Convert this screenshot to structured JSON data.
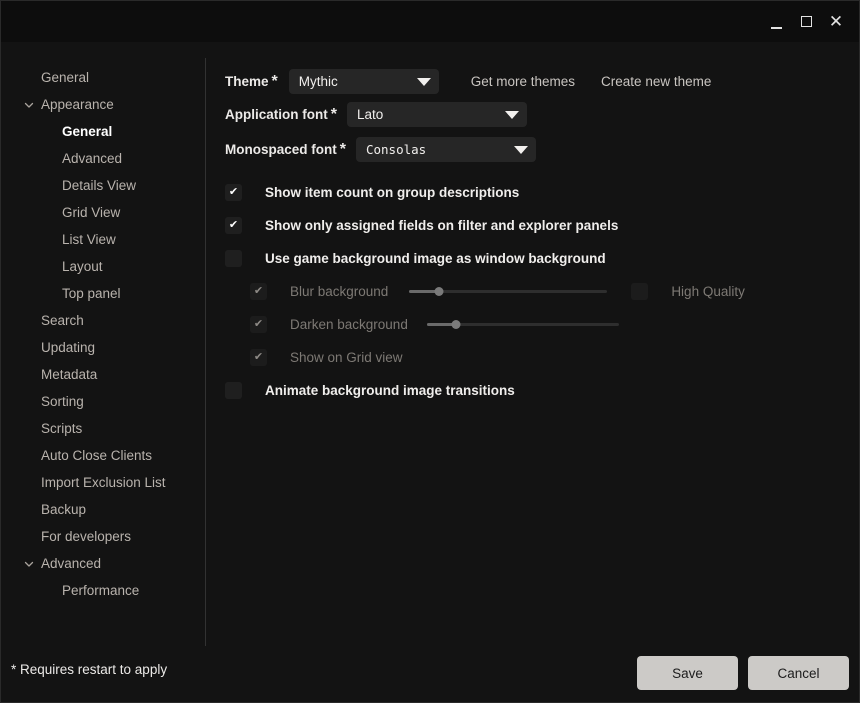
{
  "window": {
    "controls": {
      "minimize": "_",
      "maximize": "□",
      "close": "✕"
    }
  },
  "sidebar": {
    "items": [
      {
        "label": "General",
        "level": 0,
        "expandable": false,
        "selected": false
      },
      {
        "label": "Appearance",
        "level": 0,
        "expandable": true,
        "expanded": true,
        "selected": false
      },
      {
        "label": "General",
        "level": 1,
        "expandable": false,
        "selected": true
      },
      {
        "label": "Advanced",
        "level": 1,
        "expandable": false,
        "selected": false
      },
      {
        "label": "Details View",
        "level": 1,
        "expandable": false,
        "selected": false
      },
      {
        "label": "Grid View",
        "level": 1,
        "expandable": false,
        "selected": false
      },
      {
        "label": "List View",
        "level": 1,
        "expandable": false,
        "selected": false
      },
      {
        "label": "Layout",
        "level": 1,
        "expandable": false,
        "selected": false
      },
      {
        "label": "Top panel",
        "level": 1,
        "expandable": false,
        "selected": false
      },
      {
        "label": "Search",
        "level": 0,
        "expandable": false,
        "selected": false
      },
      {
        "label": "Updating",
        "level": 0,
        "expandable": false,
        "selected": false
      },
      {
        "label": "Metadata",
        "level": 0,
        "expandable": false,
        "selected": false
      },
      {
        "label": "Sorting",
        "level": 0,
        "expandable": false,
        "selected": false
      },
      {
        "label": "Scripts",
        "level": 0,
        "expandable": false,
        "selected": false
      },
      {
        "label": "Auto Close Clients",
        "level": 0,
        "expandable": false,
        "selected": false
      },
      {
        "label": "Import Exclusion List",
        "level": 0,
        "expandable": false,
        "selected": false
      },
      {
        "label": "Backup",
        "level": 0,
        "expandable": false,
        "selected": false
      },
      {
        "label": "For developers",
        "level": 0,
        "expandable": false,
        "selected": false
      },
      {
        "label": "Advanced",
        "level": 0,
        "expandable": true,
        "expanded": true,
        "selected": false
      },
      {
        "label": "Performance",
        "level": 1,
        "expandable": false,
        "selected": false
      }
    ]
  },
  "main": {
    "theme": {
      "label": "Theme",
      "required_marker": "*",
      "value": "Mythic",
      "get_more_link": "Get more themes",
      "create_link": "Create new theme"
    },
    "application_font": {
      "label": "Application font",
      "required_marker": "*",
      "value": "Lato"
    },
    "monospaced_font": {
      "label": "Monospaced font",
      "required_marker": "*",
      "value": "Consolas"
    },
    "checkboxes": {
      "show_item_count": {
        "label": "Show item count on group descriptions",
        "checked": true,
        "enabled": true,
        "tick": "✔"
      },
      "show_only_assigned_fields": {
        "label": "Show only assigned fields on filter and explorer panels",
        "checked": true,
        "enabled": true,
        "tick": "✔"
      },
      "use_game_background": {
        "label": "Use game background image as window background",
        "checked": false,
        "enabled": true,
        "tick": ""
      },
      "blur_background": {
        "label": "Blur background",
        "checked": true,
        "enabled": false,
        "tick": "✔"
      },
      "high_quality": {
        "label": "High Quality",
        "checked": false,
        "enabled": false,
        "tick": ""
      },
      "darken_background": {
        "label": "Darken background",
        "checked": true,
        "enabled": false,
        "tick": "✔"
      },
      "show_on_grid_view": {
        "label": "Show on Grid view",
        "checked": true,
        "enabled": false,
        "tick": "✔"
      },
      "animate_transitions": {
        "label": "Animate background image transitions",
        "checked": false,
        "enabled": true,
        "tick": ""
      }
    },
    "sliders": {
      "blur": {
        "percent": 15
      },
      "darken": {
        "percent": 15
      }
    }
  },
  "footer": {
    "restart_note": "* Requires restart to apply",
    "save_label": "Save",
    "cancel_label": "Cancel"
  },
  "colors": {
    "window_bg": "#131313",
    "titlebar_bg": "#0d0d0d",
    "control_bg": "#262626",
    "accent_button": "#cccac7",
    "text_primary": "#f0eeec",
    "text_muted": "#7d7974",
    "divider": "#323232"
  }
}
